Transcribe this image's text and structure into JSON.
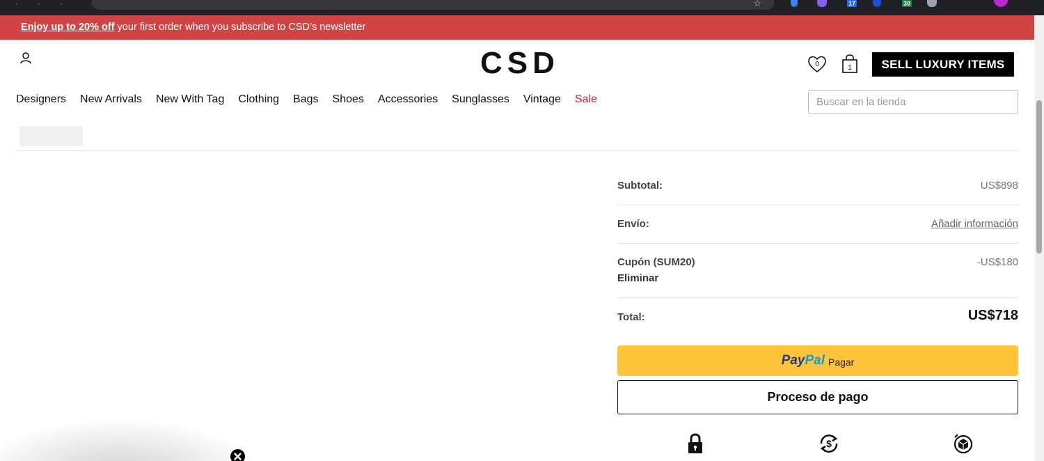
{
  "promo": {
    "highlight": "Enjoy up to 20% off",
    "rest": " your first order when you subscribe to CSD’s newsletter"
  },
  "header": {
    "logo": "CSD",
    "wishlist_count": "0",
    "cart_count": "1",
    "sell_button": "SELL LUXURY ITEMS"
  },
  "nav": {
    "items": [
      "Designers",
      "New Arrivals",
      "New With Tag",
      "Clothing",
      "Bags",
      "Shoes",
      "Accessories",
      "Sunglasses",
      "Vintage"
    ],
    "sale": "Sale"
  },
  "search": {
    "placeholder": "Buscar en la tienda"
  },
  "summary": {
    "subtotal_label": "Subtotal:",
    "subtotal_value": "US$898",
    "shipping_label": "Envío:",
    "shipping_value": "Añadir información",
    "coupon_label": "Cupón (SUM20)",
    "coupon_remove": "Eliminar",
    "coupon_value": "-US$180",
    "total_label": "Total:",
    "total_value": "US$718"
  },
  "paypal": {
    "brand_pay": "Pay",
    "brand_pal": "Pal",
    "label": "Pagar"
  },
  "checkout": {
    "label": "Proceso de pago"
  },
  "colors": {
    "promo": "#d24444",
    "sale": "#c0222a",
    "paypal": "#ffc439"
  },
  "icons": [
    "account-icon",
    "heart-icon",
    "cart-icon",
    "lock-icon",
    "money-back-icon",
    "box-icon",
    "close-icon"
  ]
}
